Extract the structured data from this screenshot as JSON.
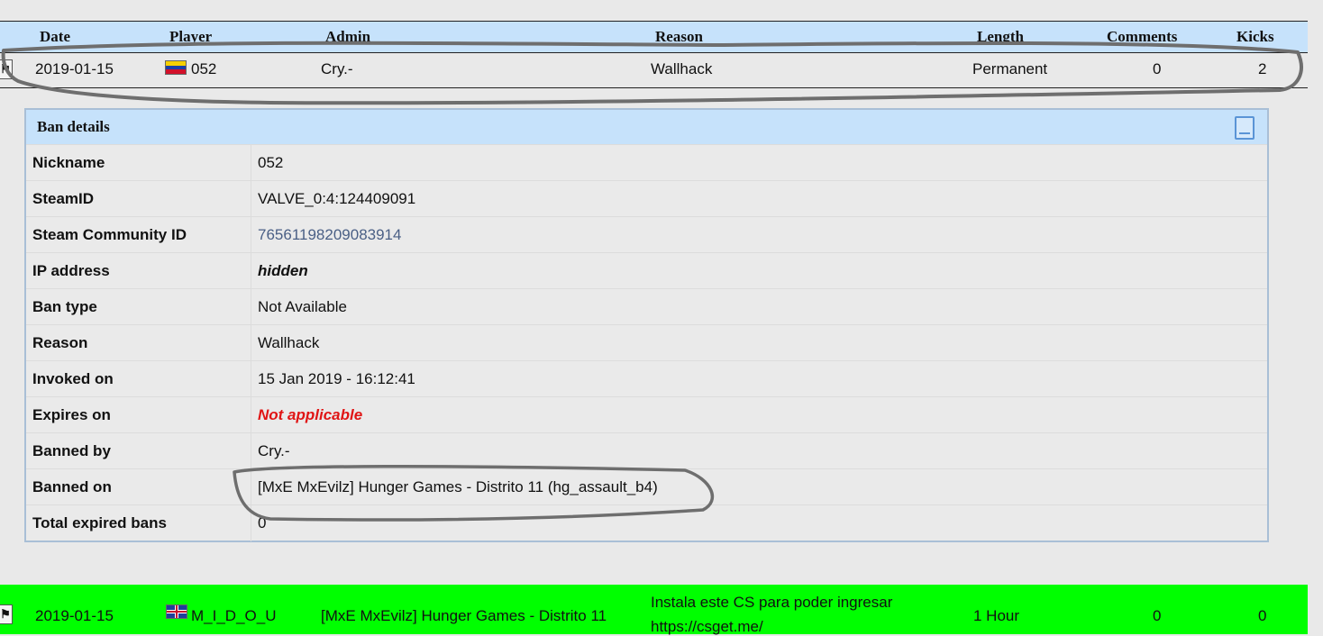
{
  "table": {
    "headers": [
      "Date",
      "Player",
      "Admin",
      "Reason",
      "Length",
      "Comments",
      "Kicks"
    ]
  },
  "ban_row": {
    "date": "2019-01-15",
    "player": "052",
    "admin": "Cry.-",
    "reason": "Wallhack",
    "length": "Permanent",
    "comments": "0",
    "kicks": "2"
  },
  "details": {
    "title": "Ban details",
    "rows": [
      {
        "label": "Nickname",
        "value": "052"
      },
      {
        "label": "SteamID",
        "value": "VALVE_0:4:124409091"
      },
      {
        "label": "Steam Community ID",
        "value": "76561198209083914"
      },
      {
        "label": "IP address",
        "value": "hidden"
      },
      {
        "label": "Ban type",
        "value": "Not Available"
      },
      {
        "label": "Reason",
        "value": "Wallhack"
      },
      {
        "label": "Invoked on",
        "value": "15 Jan 2019 - 16:12:41"
      },
      {
        "label": "Expires on",
        "value": "Not applicable"
      },
      {
        "label": "Banned by",
        "value": "Cry.-"
      },
      {
        "label": "Banned on",
        "value": "[MxE MxEvilz] Hunger Games - Distrito 11 (hg_assault_b4)"
      },
      {
        "label": "Total expired bans",
        "value": "0"
      }
    ]
  },
  "next_row": {
    "date": "2019-01-15",
    "player": "M_I_D_O_U",
    "admin": "[MxE MxEvilz] Hunger Games - Distrito 11",
    "reason_line1": "Instala este CS para poder ingresar",
    "reason_line2": "https://csget.me/",
    "length": "1 Hour",
    "comments": "0",
    "kicks": "0"
  },
  "colors": {
    "header_bg": "#c6e2fb",
    "highlight_row": "#00ff00",
    "expires_red": "#e01515",
    "link": "#4a5f85"
  },
  "icons": [
    "game-mod-icon",
    "venezuela-flag-icon",
    "uk-flag-icon",
    "document-icon"
  ]
}
